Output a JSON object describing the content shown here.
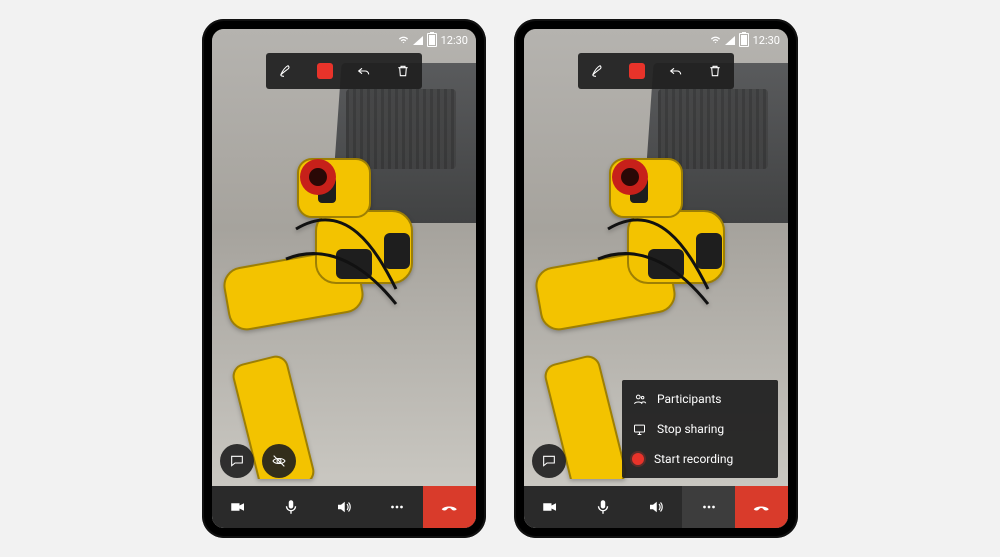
{
  "statusbar": {
    "time": "12:30"
  },
  "topToolbar": {
    "penIcon": "pen-icon",
    "colorIcon": "color-swatch-red",
    "undoIcon": "undo-icon",
    "deleteIcon": "trash-icon"
  },
  "bottomBar": {
    "cameraIcon": "video-icon",
    "micIcon": "mic-icon",
    "speakerIcon": "speaker-icon",
    "moreIcon": "more-icon",
    "endIcon": "end-call-icon"
  },
  "floating": {
    "chatIcon": "chat-icon",
    "eyeOffIcon": "mask-off-icon"
  },
  "moreMenu": {
    "items": [
      {
        "icon": "participants-icon",
        "label": "Participants"
      },
      {
        "icon": "stop-sharing-icon",
        "label": "Stop sharing"
      },
      {
        "icon": "record-icon",
        "label": "Start recording"
      }
    ]
  },
  "colors": {
    "accentRed": "#E8332A",
    "endCallRed": "#D93B2B",
    "barDark": "#2A2A2A"
  }
}
